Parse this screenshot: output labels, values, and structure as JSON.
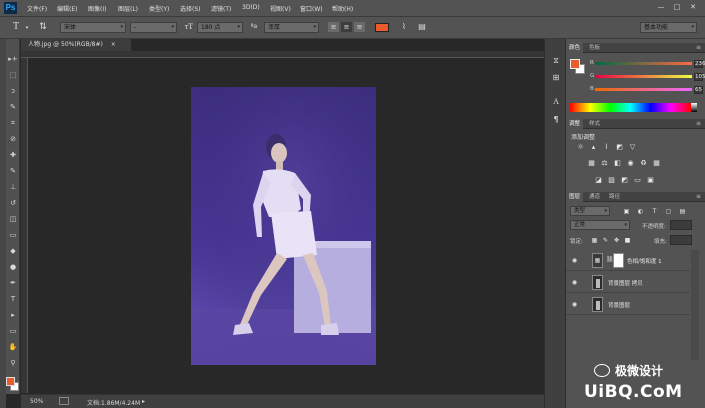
{
  "app": {
    "logo": "Ps"
  },
  "menu": [
    "文件(F)",
    "编辑(E)",
    "图像(I)",
    "图层(L)",
    "类型(Y)",
    "选择(S)",
    "滤镜(T)",
    "3D(D)",
    "视图(V)",
    "窗口(W)",
    "帮助(H)"
  ],
  "window_buttons": [
    "—",
    "□",
    "✕"
  ],
  "options": {
    "font_family": "宋体",
    "font_style": "-",
    "font_size": "180 点",
    "aa_label": "ªa",
    "aa_mode": "浑厚",
    "workspace": "基本功能",
    "text_color": "#ea5b2e"
  },
  "document": {
    "tab_title": "人物.jpg @ 50%(RGB/8#)",
    "tab_close": "×",
    "zoom": "50%",
    "doc_size": "文档:1.86M/4.24M"
  },
  "tools": [
    "move-tool",
    "marquee-tool",
    "lasso-tool",
    "quick-select-tool",
    "crop-tool",
    "eyedropper-tool",
    "healing-brush-tool",
    "brush-tool",
    "clone-stamp-tool",
    "history-brush-tool",
    "eraser-tool",
    "gradient-tool",
    "blur-tool",
    "dodge-tool",
    "pen-tool",
    "type-tool",
    "path-select-tool",
    "shape-tool",
    "hand-tool",
    "zoom-tool"
  ],
  "tool_glyphs": [
    "▸+",
    "⬚",
    "ↄ",
    "✎",
    "⌗",
    "⊘",
    "✚",
    "✎",
    "⊥",
    "↺",
    "◫",
    "▭",
    "◆",
    "●",
    "✒",
    "T",
    "▸",
    "▭",
    "✋",
    "⚲"
  ],
  "colors": {
    "foreground": "#ea5b2e",
    "background": "#ffffff"
  },
  "color_panel": {
    "tabs": [
      "颜色",
      "色板"
    ],
    "r_label": "R",
    "r_value": "236",
    "g_label": "G",
    "g_value": "105",
    "b_label": "B",
    "b_value": "65"
  },
  "adjust_panel": {
    "tabs": [
      "调整",
      "样式"
    ],
    "title": "添加调整"
  },
  "layers_panel": {
    "tabs": [
      "图层",
      "通道",
      "路径"
    ],
    "filter": "类型",
    "blend_mode": "正常",
    "opacity_label": "不透明度:",
    "lock_label": "锁定:",
    "fill_label": "填充:",
    "layers": [
      {
        "name": "色相/饱和度 1"
      },
      {
        "name": "背景图层 拷贝"
      },
      {
        "name": "背景图层"
      }
    ]
  },
  "watermark": {
    "brand": "极微设计",
    "site": "UiBQ.CoM"
  }
}
